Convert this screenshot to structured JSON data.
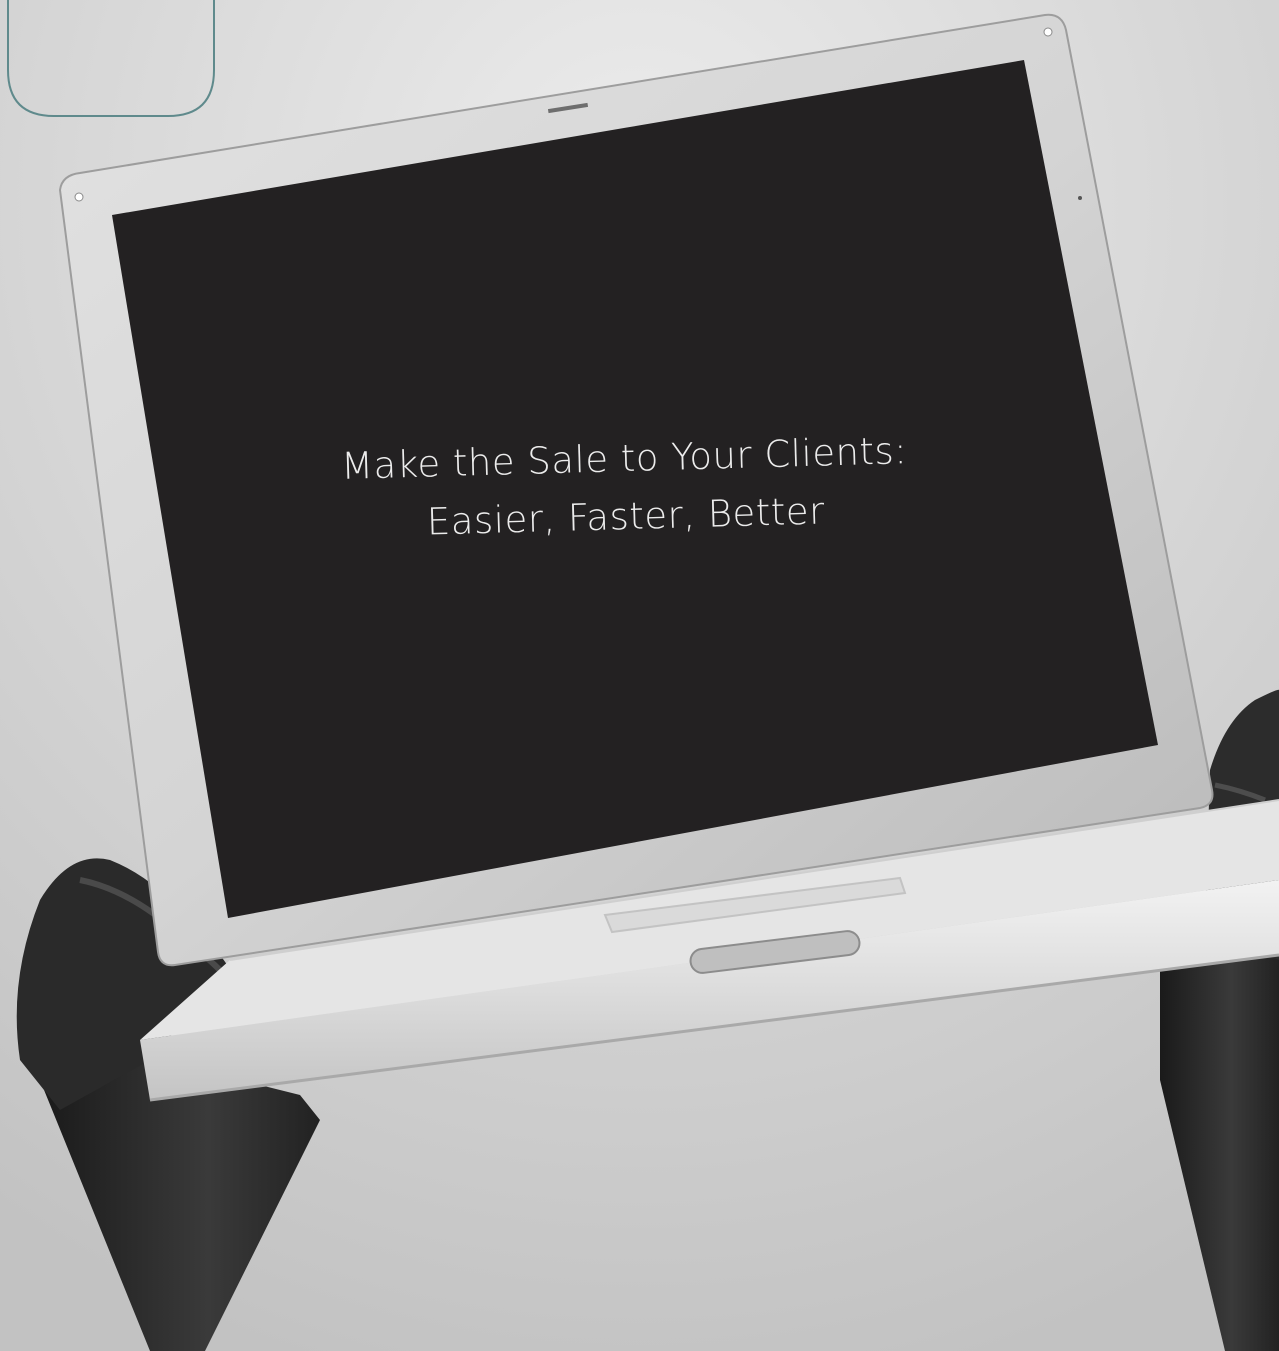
{
  "screen": {
    "headline_line1": "Make the Sale to Your Clients:",
    "headline_line2": "Easier, Faster, Better"
  },
  "colors": {
    "screen": "#232122",
    "bezel": "#d8d8d8",
    "sky": "#d6d6d6",
    "corner_outline": "#5f8a8c",
    "corner_accent": "#3f6fa6"
  }
}
